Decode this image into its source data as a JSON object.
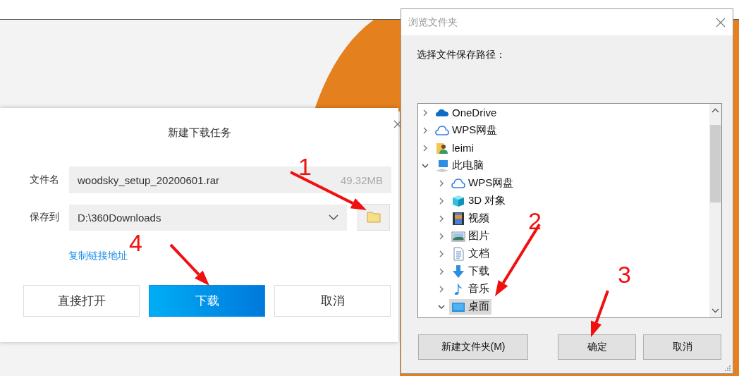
{
  "download_dialog": {
    "title": "新建下载任务",
    "filename_label": "文件名",
    "filename": "woodsky_setup_20200601.rar",
    "file_size": "49.32MB",
    "save_label": "保存到",
    "save_path": "D:\\360Downloads",
    "copy_link": "复制链接地址",
    "buttons": [
      {
        "label": "直接打开",
        "kind": "normal"
      },
      {
        "label": "下载",
        "kind": "primary"
      },
      {
        "label": "取消",
        "kind": "normal"
      }
    ]
  },
  "browse_dialog": {
    "title": "浏览文件夹",
    "prompt": "选择文件保存路径：",
    "tree": [
      {
        "label": "OneDrive",
        "kind": "onedrive",
        "expanded": false,
        "selected": false
      },
      {
        "label": "WPS网盘",
        "kind": "cloud",
        "expanded": false,
        "selected": false
      },
      {
        "label": "leimi",
        "kind": "user",
        "expanded": false,
        "selected": false
      },
      {
        "label": "此电脑",
        "kind": "computer",
        "expanded": true,
        "selected": false,
        "children": [
          {
            "label": "WPS网盘",
            "kind": "cloud",
            "expanded": false,
            "selected": false
          },
          {
            "label": "3D 对象",
            "kind": "cube",
            "expanded": false,
            "selected": false
          },
          {
            "label": "视频",
            "kind": "video",
            "expanded": false,
            "selected": false
          },
          {
            "label": "图片",
            "kind": "image",
            "expanded": false,
            "selected": false
          },
          {
            "label": "文档",
            "kind": "document",
            "expanded": false,
            "selected": false
          },
          {
            "label": "下载",
            "kind": "download",
            "expanded": false,
            "selected": false
          },
          {
            "label": "音乐",
            "kind": "music",
            "expanded": false,
            "selected": false
          },
          {
            "label": "桌面",
            "kind": "desktop",
            "expanded": true,
            "selected": true
          }
        ]
      }
    ],
    "buttons": [
      {
        "label": "新建文件夹(M)"
      },
      {
        "label": "确定"
      },
      {
        "label": "取消"
      }
    ]
  },
  "annotations": [
    {
      "label": "1"
    },
    {
      "label": "2"
    },
    {
      "label": "3"
    },
    {
      "label": "4"
    }
  ]
}
